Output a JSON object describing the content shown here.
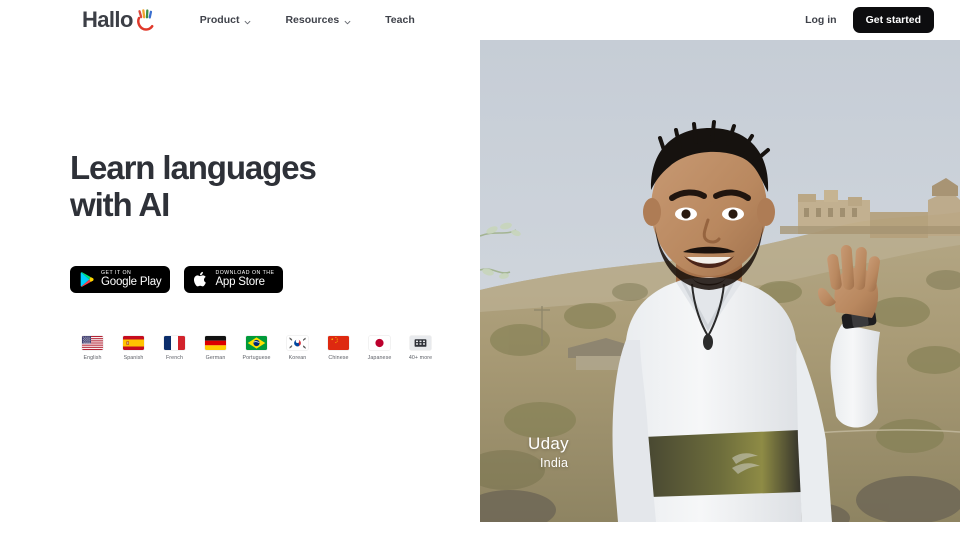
{
  "brand": {
    "name": "Hallo",
    "mark_icon": "waving-hand-icon"
  },
  "nav": {
    "links": [
      {
        "label": "Product",
        "icon": "chevron-down-icon",
        "has_chevron": true
      },
      {
        "label": "Resources",
        "icon": "chevron-down-icon",
        "has_chevron": true
      },
      {
        "label": "Teach",
        "has_chevron": false
      }
    ],
    "login_label": "Log in",
    "cta_label": "Get started",
    "cta_color": "#0d0d0f"
  },
  "hero": {
    "headline": "Learn languages\nwith AI",
    "badges": [
      {
        "small": "GET IT ON",
        "big": "Google Play",
        "icon": "google-play-icon"
      },
      {
        "small": "Download on the",
        "big": "App Store",
        "icon": "apple-icon"
      }
    ],
    "flags": [
      {
        "label": "English",
        "icon": "flag-us-icon"
      },
      {
        "label": "Spanish",
        "icon": "flag-es-icon"
      },
      {
        "label": "French",
        "icon": "flag-fr-icon"
      },
      {
        "label": "German",
        "icon": "flag-de-icon"
      },
      {
        "label": "Portuguese",
        "icon": "flag-br-icon"
      },
      {
        "label": "Korean",
        "icon": "flag-kr-icon"
      },
      {
        "label": "Chinese",
        "icon": "flag-cn-icon"
      },
      {
        "label": "Japanese",
        "icon": "flag-jp-icon"
      },
      {
        "label": "40+ more",
        "icon": "more-languages-icon"
      }
    ]
  },
  "photo": {
    "caption_name": "Uday",
    "caption_country": "India",
    "alt": "smiling man waving in front of a hillside fort"
  }
}
